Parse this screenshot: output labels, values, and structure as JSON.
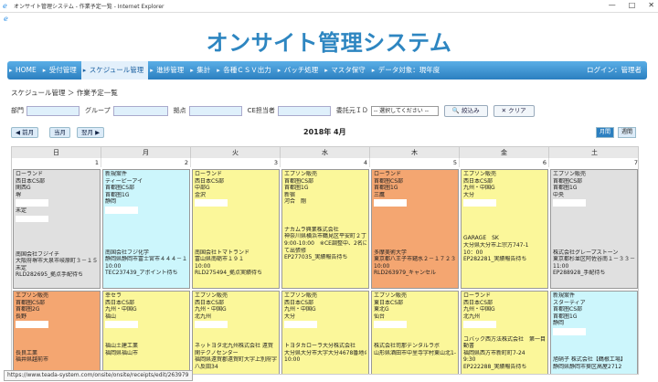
{
  "window": {
    "title": "オンサイト管理システム - 作業予定一覧 - Internet Explorer",
    "controls": [
      "—",
      "□",
      "✕"
    ]
  },
  "app": {
    "brand": "オンサイト管理システム"
  },
  "nav": {
    "items": [
      "HOME",
      "受付管理",
      "スケジュール管理",
      "進捗管理",
      "集計",
      "各種ＣＳＶ出力",
      "バッチ処理",
      "マスタ保守",
      "データ対象：現年度"
    ],
    "login": "ログイン：管理者"
  },
  "breadcrumb": "スケジュール管理 ＞ 作業予定一覧",
  "filters": {
    "labels": [
      "部門",
      "グループ",
      "拠点",
      "CE担当者",
      "委託元ＩＤ"
    ],
    "select_value": "-- 選択してください --",
    "search_label": "絞込み",
    "clear_label": "クリア"
  },
  "calnav": {
    "prev_month": "◀ 前月",
    "this_month": "当月",
    "next_month": "翌月 ▶",
    "month_title": "2018年 4月",
    "view_month": "月間",
    "view_week": "週間"
  },
  "calendar": {
    "days_of_week": [
      "日",
      "月",
      "火",
      "水",
      "木",
      "金",
      "土"
    ],
    "dates": [
      "1",
      "2",
      "3",
      "4",
      "5",
      "6",
      "7"
    ],
    "events_week1": [
      {
        "lines": [
          "ローランド",
          "西日本CS部",
          "関西G",
          "堺",
          "",
          "未定",
          "",
          "",
          "",
          "",
          "",
          "南国会社フジイチ",
          "大阪府堺市大泉市岐原町３－１５－２０",
          "未定",
          "RLD282695_拠点手配待ち"
        ],
        "blanks": [
          4,
          6
        ]
      },
      {
        "lines": [
          "新規案件",
          "ティーピーアイ",
          "首都圏CS部",
          "首都圏1G",
          "静岡",
          "",
          "",
          "",
          "",
          "",
          "",
          "南国会社フジ化学",
          "静岡県静岡市富士宮市４４４－１",
          "10:00",
          "TEC237439_アポイント待ち"
        ],
        "blanks": [
          5
        ]
      },
      {
        "lines": [
          "ローランド",
          "西日本CS部",
          "中部G",
          "金沢",
          "",
          "",
          "",
          "",
          "",
          "",
          "",
          "南国会社トマトランド",
          "富山県南砺市１９１",
          "10:00",
          "RLD275494_拠点実績待ち"
        ],
        "blanks": [
          4
        ]
      },
      {
        "lines": [
          "エプソン販売",
          "首都圏CS部",
          "首都圏1G",
          "新宿",
          "河合　剛",
          "",
          "",
          "",
          "ナカムラ興業株式会社",
          "神奈川県横浜市鶴見区平安町２丁目１２－１８",
          "9:00-10:00　※CE調整中、2名に",
          "て出張修",
          "EP277035_実績報告待ち"
        ],
        "blanks": []
      },
      {
        "lines": [
          "ローランド",
          "首都圏CS部",
          "首都圏1G",
          "三鷹",
          "",
          "",
          "",
          "",
          "",
          "",
          "",
          "多摩美術大学",
          "東京都八王子市鑓水２－１７２３",
          "10:00",
          "RLD263979_キャンセル"
        ],
        "blanks": [
          4
        ]
      },
      {
        "lines": [
          "エプソン販売",
          "西日本CS部",
          "九州・中国G",
          "大分",
          "",
          "",
          "",
          "",
          "",
          "GARAGE　SK",
          "大分県大分市上宗方747-1",
          "10：00",
          "EP282281_実績報告待ち"
        ],
        "blanks": [
          4
        ]
      },
      {
        "lines": [
          "エプソン販売",
          "首都圏CS部",
          "首都圏1G",
          "中央",
          "",
          "",
          "",
          "",
          "",
          "",
          "",
          "株式会社グレープストーン",
          "東京都杉並区阿佐谷南１－３３－２",
          "11:00",
          "EP288928_手配待ち"
        ],
        "blanks": [
          4
        ]
      }
    ],
    "events_week2": [
      {
        "lines": [
          "エプソン販売",
          "首都圏CS部",
          "首都圏2G",
          "長野",
          "",
          "",
          "",
          "",
          "長良工業",
          "福井県越前市"
        ],
        "blanks": [
          4
        ]
      },
      {
        "lines": [
          "幸セラ",
          "西日本CS部",
          "九州・中国G",
          "福山",
          "",
          "",
          "",
          "福山土建工業",
          "福岡県福山市"
        ],
        "blanks": [
          4
        ]
      },
      {
        "lines": [
          "エプソン販売",
          "西日本CS部",
          "九州・中国G",
          "北九州",
          "",
          "",
          "",
          "ネットヨタ北九州株式会社 遠賀",
          "関テクノセンター",
          "福岡県遠賀郡遠賀町大字上別府字",
          "八反田34"
        ],
        "blanks": [
          4
        ]
      },
      {
        "lines": [
          "エプソン販売",
          "西日本CS部",
          "九州・中国G",
          "大分",
          "",
          "",
          "",
          "トヨタカローラ大分株式会社",
          "大分県大分市大字大分4678番地の2",
          "10:00"
        ],
        "blanks": [
          4
        ]
      },
      {
        "lines": [
          "エプソン販売",
          "東日本CS部",
          "東北G",
          "仙台",
          "",
          "",
          "",
          "株式会社司那デンタルラボ",
          "山形県酒田市中里寺字村東山北1-24"
        ],
        "blanks": [
          4
        ]
      },
      {
        "lines": [
          "ローランド",
          "西日本CS部",
          "九州・中国G",
          "北九州",
          "",
          "",
          "コバック西方法株式会社　第一目",
          "動書",
          "福岡県西方市新町町7-24",
          "9:30",
          "EP222288_実績報告待ち"
        ],
        "blanks": [
          4
        ]
      },
      {
        "lines": [
          "新規案件",
          "スターティア",
          "首都圏CS部",
          "首都圏1G",
          "静岡",
          "",
          "",
          "",
          "",
          "旭硝子 株式会社【鶴根工場】",
          "静岡県静岡市葵区高屋2712"
        ],
        "blanks": [
          5
        ]
      }
    ]
  },
  "status_url": "https://www.teada-system.com/onsite/onsite/receipts/edit/263979"
}
